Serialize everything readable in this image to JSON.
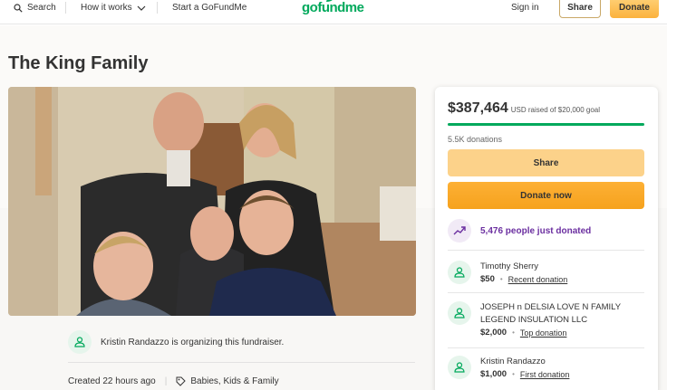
{
  "header": {
    "search_label": "Search",
    "how_it_works_label": "How it works",
    "start_label": "Start a GoFundMe",
    "logo_text": "gofundme",
    "sign_in_label": "Sign in",
    "share_label": "Share",
    "donate_label": "Donate"
  },
  "campaign": {
    "title": "The King Family",
    "organizer_text": "Kristin Randazzo is organizing this fundraiser.",
    "created_text": "Created 22 hours ago",
    "category": "Babies, Kids & Family"
  },
  "sidebar": {
    "raised_amount": "$387,464",
    "raised_goal_text": "USD raised of $20,000 goal",
    "progress_fraction": 1.0,
    "donations_count": "5.5K donations",
    "share_label": "Share",
    "donate_now_label": "Donate now",
    "trend_text": "5,476 people just donated",
    "donors": [
      {
        "name": "Timothy Sherry",
        "amount": "$50",
        "kind": "Recent donation"
      },
      {
        "name": "JOSEPH n DELSIA LOVE N FAMILY LEGEND INSULATION LLC",
        "amount": "$2,000",
        "kind": "Top donation"
      },
      {
        "name": "Kristin Randazzo",
        "amount": "$1,000",
        "kind": "First donation"
      }
    ]
  },
  "colors": {
    "brand_green": "#02a95c",
    "donate_orange": "#f6a21d",
    "share_yellow": "#fcd28a",
    "trend_purple": "#6b2fa0"
  },
  "icons": [
    "search-icon",
    "chevron-down-icon",
    "tag-icon",
    "trend-up-icon",
    "user-heart-icon"
  ]
}
